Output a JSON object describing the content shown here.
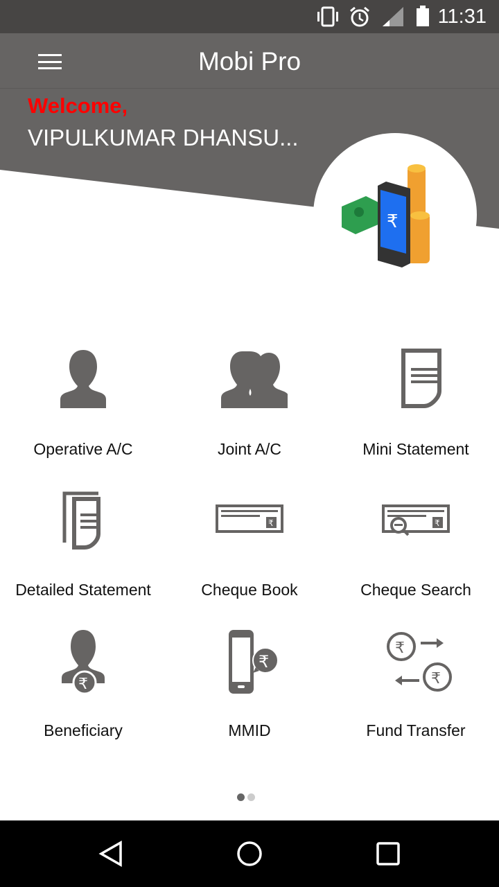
{
  "status_bar": {
    "time": "11:31",
    "icons": [
      "vibrate-icon",
      "alarm-icon",
      "signal-icon",
      "battery-icon"
    ]
  },
  "app_bar": {
    "title": "Mobi Pro",
    "menu_icon": "hamburger-icon"
  },
  "banner": {
    "welcome": "Welcome,",
    "user_name": "VIPULKUMAR DHANSU...",
    "illustration": "phone-money-coins"
  },
  "menu_items": [
    {
      "label": "Operative A/C",
      "icon": "person-icon"
    },
    {
      "label": "Joint A/C",
      "icon": "two-persons-icon"
    },
    {
      "label": "Mini Statement",
      "icon": "document-icon"
    },
    {
      "label": "Detailed Statement",
      "icon": "documents-icon"
    },
    {
      "label": "Cheque Book",
      "icon": "cheque-icon"
    },
    {
      "label": "Cheque Search",
      "icon": "cheque-search-icon"
    },
    {
      "label": "Beneficiary",
      "icon": "beneficiary-icon"
    },
    {
      "label": "MMID",
      "icon": "mobile-rupee-icon"
    },
    {
      "label": "Fund Transfer",
      "icon": "fund-transfer-icon"
    }
  ],
  "pager": {
    "pages": 2,
    "current": 1
  },
  "colors": {
    "header": "#666463",
    "status_bar": "#474544",
    "welcome": "#ff0000",
    "icon": "#666463"
  }
}
